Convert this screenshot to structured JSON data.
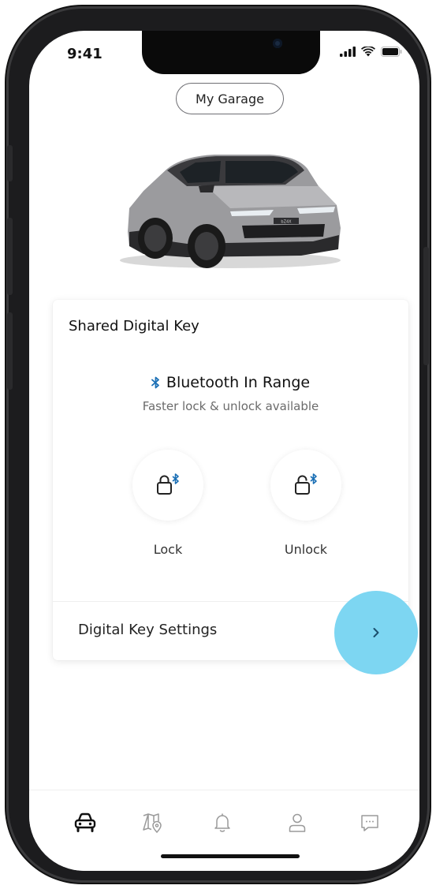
{
  "status_bar": {
    "time": "9:41"
  },
  "header": {
    "garage_label": "My Garage"
  },
  "vehicle": {
    "badge": "bZ4X"
  },
  "card": {
    "title": "Shared Digital Key",
    "bluetooth_status": "Bluetooth In Range",
    "bluetooth_sub": "Faster lock & unlock available",
    "lock_label": "Lock",
    "unlock_label": "Unlock",
    "settings_label": "Digital Key Settings"
  },
  "bottom_nav": {
    "items": [
      {
        "icon": "car-icon",
        "active": true
      },
      {
        "icon": "map-pin-icon",
        "active": false
      },
      {
        "icon": "bell-icon",
        "active": false
      },
      {
        "icon": "user-icon",
        "active": false
      },
      {
        "icon": "chat-icon",
        "active": false
      }
    ]
  },
  "colors": {
    "accent_blue": "#1a6fb5",
    "highlight": "#7dd6f2",
    "inactive_icon": "#9a9a9a"
  }
}
